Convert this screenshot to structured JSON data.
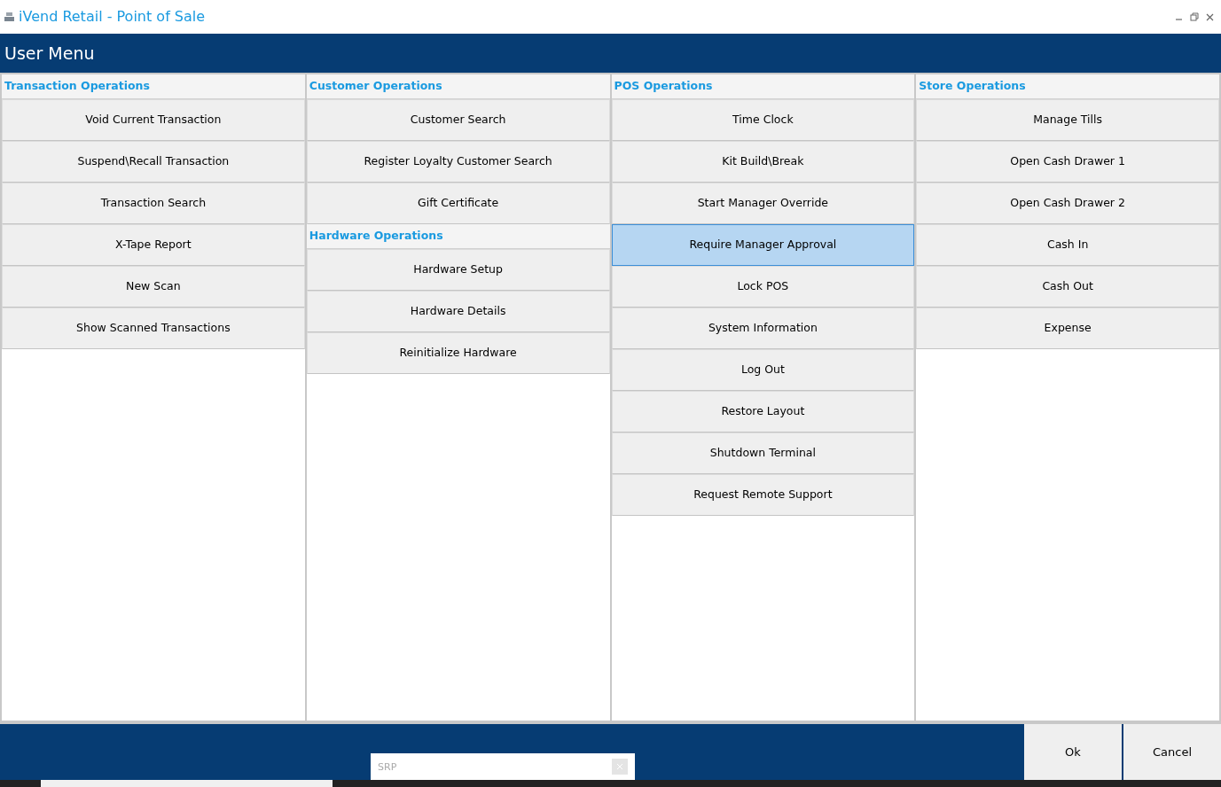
{
  "window": {
    "title": "iVend Retail - Point of Sale"
  },
  "header": {
    "title": "User Menu"
  },
  "columns": [
    {
      "sections": [
        {
          "heading": "Transaction Operations",
          "items": [
            {
              "label": "Void Current Transaction",
              "selected": false
            },
            {
              "label": "Suspend\\Recall Transaction",
              "selected": false
            },
            {
              "label": "Transaction Search",
              "selected": false
            },
            {
              "label": "X-Tape Report",
              "selected": false
            },
            {
              "label": "New Scan",
              "selected": false
            },
            {
              "label": "Show Scanned Transactions",
              "selected": false
            }
          ]
        }
      ]
    },
    {
      "sections": [
        {
          "heading": "Customer Operations",
          "items": [
            {
              "label": "Customer Search",
              "selected": false
            },
            {
              "label": "Register Loyalty Customer Search",
              "selected": false
            },
            {
              "label": "Gift Certificate",
              "selected": false
            }
          ]
        },
        {
          "heading": "Hardware Operations",
          "items": [
            {
              "label": "Hardware Setup",
              "selected": false
            },
            {
              "label": "Hardware Details",
              "selected": false
            },
            {
              "label": "Reinitialize Hardware",
              "selected": false
            }
          ]
        }
      ]
    },
    {
      "sections": [
        {
          "heading": "POS Operations",
          "items": [
            {
              "label": "Time Clock",
              "selected": false
            },
            {
              "label": "Kit Build\\Break",
              "selected": false
            },
            {
              "label": "Start Manager Override",
              "selected": false
            },
            {
              "label": "Require Manager Approval",
              "selected": true
            },
            {
              "label": "Lock POS",
              "selected": false
            },
            {
              "label": "System Information",
              "selected": false
            },
            {
              "label": "Log Out",
              "selected": false
            },
            {
              "label": "Restore Layout",
              "selected": false
            },
            {
              "label": "Shutdown Terminal",
              "selected": false
            },
            {
              "label": "Request Remote Support",
              "selected": false
            }
          ]
        }
      ]
    },
    {
      "sections": [
        {
          "heading": "Store Operations",
          "items": [
            {
              "label": "Manage Tills",
              "selected": false
            },
            {
              "label": "Open Cash Drawer 1",
              "selected": false
            },
            {
              "label": "Open Cash Drawer 2",
              "selected": false
            },
            {
              "label": "Cash In",
              "selected": false
            },
            {
              "label": "Cash Out",
              "selected": false
            },
            {
              "label": "Expense",
              "selected": false
            }
          ]
        }
      ]
    }
  ],
  "footer": {
    "search": {
      "placeholder": "SRP"
    },
    "buttons": [
      "Ok",
      "Cancel"
    ]
  }
}
